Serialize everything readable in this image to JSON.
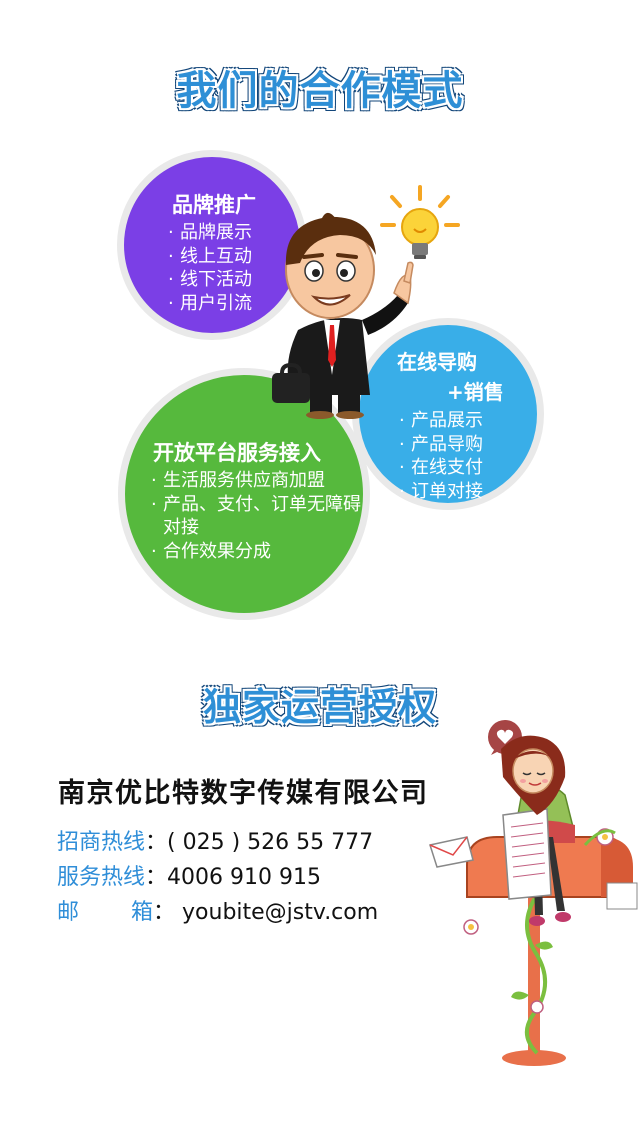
{
  "section1": {
    "heading": "我们的合作模式",
    "brand": {
      "title": "品牌推广",
      "items": [
        "品牌展示",
        "线上互动",
        "线下活动",
        "用户引流"
      ],
      "color": "#7b3fe6"
    },
    "platform": {
      "title": "开放平台服务接入",
      "items": [
        "生活服务供应商加盟",
        "产品、支付、订单无障碍对接",
        "合作效果分成"
      ],
      "color": "#56b93d"
    },
    "shopping": {
      "title_line1": "在线导购",
      "title_line2": "+销售",
      "items": [
        "产品展示",
        "产品导购",
        "在线支付",
        "订单对接"
      ],
      "color": "#39aee8"
    },
    "illustration_icon": "businessman-with-lightbulb-icon"
  },
  "section2": {
    "heading": "独家运营授权",
    "company": "南京优比特数字传媒有限公司",
    "contacts": [
      {
        "label": "招商热线",
        "sep": "：",
        "value": "( 025 ) 526 55 777"
      },
      {
        "label": "服务热线",
        "sep": "：",
        "value": "4006 910 915"
      },
      {
        "label_a": "邮",
        "label_b": "箱",
        "sep": "：",
        "value": "youbite@jstv.com"
      }
    ],
    "illustration_icon": "girl-on-mailbox-icon"
  },
  "colors": {
    "heading": "#2e8fd6",
    "label": "#2f8ed8"
  }
}
